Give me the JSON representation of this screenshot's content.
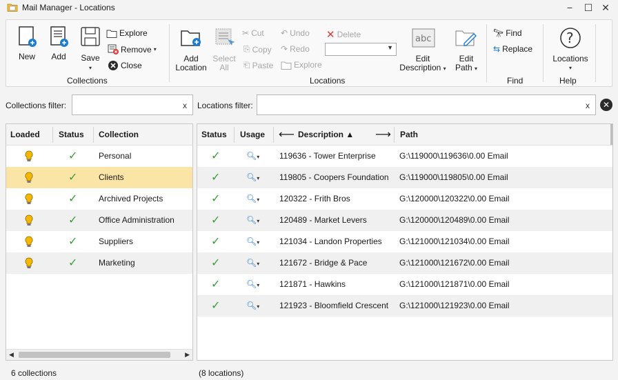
{
  "window": {
    "title": "Mail Manager - Locations"
  },
  "ribbon": {
    "collections": {
      "new": "New",
      "add": "Add",
      "save": "Save",
      "explore": "Explore",
      "remove": "Remove",
      "close": "Close",
      "group": "Collections"
    },
    "locations": {
      "add_location_1": "Add",
      "add_location_2": "Location",
      "select_all_1": "Select",
      "select_all_2": "All",
      "cut": "Cut",
      "copy": "Copy",
      "paste": "Paste",
      "undo": "Undo",
      "redo": "Redo",
      "explore": "Explore",
      "delete": "Delete",
      "edit_description_1": "Edit",
      "edit_description_2": "Description",
      "edit_path_1": "Edit",
      "edit_path_2": "Path",
      "group": "Locations"
    },
    "find": {
      "find": "Find",
      "replace": "Replace",
      "group": "Find"
    },
    "help": {
      "locations": "Locations",
      "group": "Help"
    }
  },
  "filters": {
    "collections_label": "Collections filter:",
    "collections_value": "",
    "locations_label": "Locations filter:",
    "locations_value": "",
    "clear": "x"
  },
  "collections_grid": {
    "headers": {
      "loaded": "Loaded",
      "status": "Status",
      "collection": "Collection"
    },
    "rows": [
      {
        "name": "Personal"
      },
      {
        "name": "Clients"
      },
      {
        "name": "Archived Projects"
      },
      {
        "name": "Office Administration"
      },
      {
        "name": "Suppliers"
      },
      {
        "name": "Marketing"
      }
    ],
    "selected_index": 1
  },
  "locations_grid": {
    "headers": {
      "status": "Status",
      "usage": "Usage",
      "description": "Description ▲",
      "path": "Path"
    },
    "rows": [
      {
        "description": "119636 - Tower Enterprise",
        "path": "G:\\119000\\119636\\0.00 Email"
      },
      {
        "description": "119805 - Coopers Foundation",
        "path": "G:\\119000\\119805\\0.00 Email"
      },
      {
        "description": "120322 - Frith Bros",
        "path": "G:\\120000\\120322\\0.00 Email"
      },
      {
        "description": "120489 - Market Levers",
        "path": "G:\\120000\\120489\\0.00 Email"
      },
      {
        "description": "121034 - Landon Properties",
        "path": "G:\\121000\\121034\\0.00 Email"
      },
      {
        "description": "121672 - Bridge & Pace",
        "path": "G:\\121000\\121672\\0.00 Email"
      },
      {
        "description": "121871 - Hawkins",
        "path": "G:\\121000\\121871\\0.00 Email"
      },
      {
        "description": "121923 - Bloomfield Crescent",
        "path": "G:\\121000\\121923\\0.00 Email"
      }
    ]
  },
  "status_bar": {
    "collections_count": "6 collections",
    "locations_count": "(8 locations)"
  },
  "colors": {
    "check": "#3a9d3a",
    "selected_row": "#fbe5a6",
    "bulb": "#f5b700",
    "accent_blue": "#1e7bd4",
    "delete_red": "#e03a3a"
  }
}
